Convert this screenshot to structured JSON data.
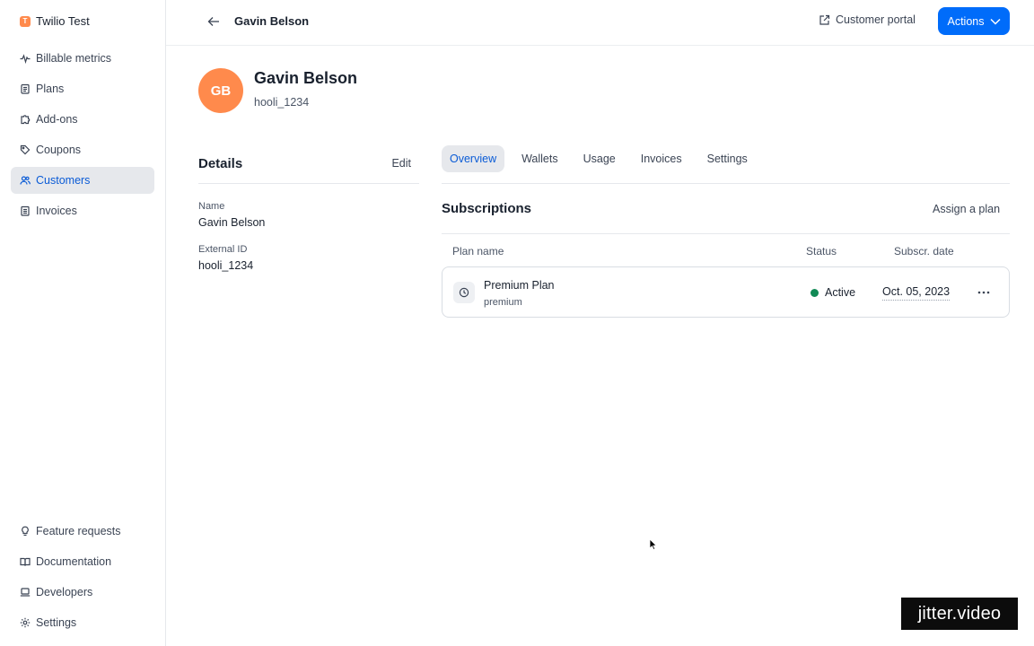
{
  "org": {
    "logo_letter": "T",
    "name": "Twilio Test"
  },
  "sidebar": {
    "top_items": [
      {
        "label": "Billable metrics",
        "icon": "pulse-icon"
      },
      {
        "label": "Plans",
        "icon": "clipboard-icon"
      },
      {
        "label": "Add-ons",
        "icon": "puzzle-icon"
      },
      {
        "label": "Coupons",
        "icon": "tag-icon"
      },
      {
        "label": "Customers",
        "icon": "users-icon",
        "active": true
      },
      {
        "label": "Invoices",
        "icon": "document-icon"
      }
    ],
    "bottom_items": [
      {
        "label": "Feature requests",
        "icon": "lightbulb-icon"
      },
      {
        "label": "Documentation",
        "icon": "book-icon"
      },
      {
        "label": "Developers",
        "icon": "laptop-icon"
      },
      {
        "label": "Settings",
        "icon": "gear-icon"
      }
    ]
  },
  "header": {
    "title": "Gavin Belson",
    "portal_label": "Customer portal",
    "actions_label": "Actions"
  },
  "customer": {
    "initials": "GB",
    "name": "Gavin Belson",
    "external_id": "hooli_1234"
  },
  "details": {
    "title": "Details",
    "edit_label": "Edit",
    "name_label": "Name",
    "name_value": "Gavin Belson",
    "external_id_label": "External ID",
    "external_id_value": "hooli_1234"
  },
  "tabs": [
    {
      "label": "Overview",
      "active": true
    },
    {
      "label": "Wallets"
    },
    {
      "label": "Usage"
    },
    {
      "label": "Invoices"
    },
    {
      "label": "Settings"
    }
  ],
  "subscriptions": {
    "title": "Subscriptions",
    "assign_label": "Assign a plan",
    "columns": {
      "plan": "Plan name",
      "status": "Status",
      "date": "Subscr. date"
    },
    "rows": [
      {
        "plan_name": "Premium Plan",
        "plan_code": "premium",
        "status": "Active",
        "date": "Oct. 05, 2023"
      }
    ]
  },
  "watermark": "jitter.video",
  "colors": {
    "accent": "#006cfa",
    "avatar": "#ff8a4c",
    "active_status": "#118a56",
    "active_nav_bg": "#e6e8ec"
  }
}
